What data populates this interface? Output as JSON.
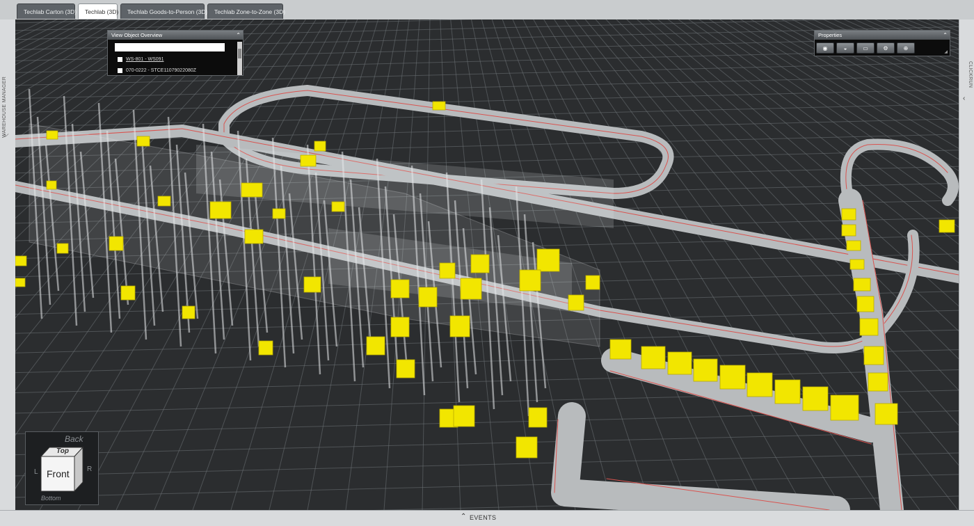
{
  "tabs": [
    {
      "label": "Techlab Carton (3D)",
      "active": false
    },
    {
      "label": "Techlab (3D)",
      "active": true
    },
    {
      "label": "Techlab Goods-to-Person (3D)",
      "active": false
    },
    {
      "label": "Techlab Zone-to-Zone (3D)",
      "active": false
    }
  ],
  "left_panel": {
    "label": "WAREHOUSE MANAGER",
    "chevron_icon": "chevron-down-icon"
  },
  "right_panel": {
    "label": "CLICKRUN",
    "chevron_icon": "chevron-left-icon"
  },
  "events_bar": {
    "label": "EVENTS",
    "chevron_icon": "chevron-up-icon"
  },
  "object_overview": {
    "title": "View Object Overview",
    "search_value": "",
    "items": [
      {
        "label": "WS-801 - WS091",
        "checked": false
      },
      {
        "label": "070-0222 - STCE11079022080Z",
        "checked": false
      }
    ]
  },
  "properties": {
    "title": "Properties",
    "buttons": [
      {
        "icon": "eye-icon"
      },
      {
        "icon": "layers-icon"
      },
      {
        "icon": "monitor-icon"
      },
      {
        "icon": "settings-icon"
      },
      {
        "icon": "add-icon"
      }
    ]
  },
  "view_cube": {
    "top": "Top",
    "front": "Front",
    "back": "Back",
    "bottom": "Bottom",
    "left": "L",
    "right": "R"
  },
  "colors": {
    "viewport_bg": "#2b2d2f",
    "grid": "#6e7276",
    "conveyor": "#b8bbbd",
    "stripe": "#d9534f",
    "tote": "#f2e600",
    "rack_glass": "#e6e8ea"
  }
}
